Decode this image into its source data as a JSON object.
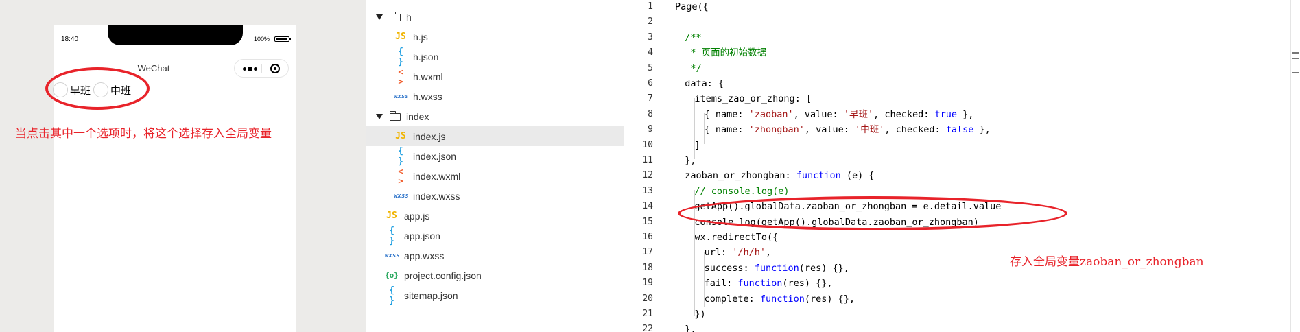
{
  "simulator": {
    "status_time": "18:40",
    "battery_text": "100%",
    "nav_title": "WeChat",
    "radio_items": [
      {
        "label": "早班"
      },
      {
        "label": "中班"
      }
    ],
    "annotation": "当点击其中一个选项时，将这个选择存入全局变量"
  },
  "file_tree": {
    "items": [
      {
        "name": "h",
        "type": "folder"
      },
      {
        "name": "h.js",
        "type": "js"
      },
      {
        "name": "h.json",
        "type": "json"
      },
      {
        "name": "h.wxml",
        "type": "wxml"
      },
      {
        "name": "h.wxss",
        "type": "wxss"
      },
      {
        "name": "index",
        "type": "folder"
      },
      {
        "name": "index.js",
        "type": "js",
        "selected": true
      },
      {
        "name": "index.json",
        "type": "json"
      },
      {
        "name": "index.wxml",
        "type": "wxml"
      },
      {
        "name": "index.wxss",
        "type": "wxss"
      },
      {
        "name": "app.js",
        "type": "js"
      },
      {
        "name": "app.json",
        "type": "json"
      },
      {
        "name": "app.wxss",
        "type": "wxss"
      },
      {
        "name": "project.config.json",
        "type": "config"
      },
      {
        "name": "sitemap.json",
        "type": "json"
      }
    ],
    "icons": {
      "js": "JS",
      "json": "{ }",
      "wxml": "< >",
      "wxss": "wxss",
      "config": "{o}"
    }
  },
  "editor": {
    "lines": [
      [
        [
          "p",
          "Page({"
        ]
      ],
      [],
      [
        [
          "c",
          "/**"
        ]
      ],
      [
        [
          "c",
          " * 页面的初始数据"
        ]
      ],
      [
        [
          "c",
          " */"
        ]
      ],
      [
        [
          "p",
          "data: {"
        ]
      ],
      [
        [
          "p",
          "items_zao_or_zhong: ["
        ]
      ],
      [
        [
          "p",
          "{ name: "
        ],
        [
          "s",
          "'zaoban'"
        ],
        [
          "p",
          ", value: "
        ],
        [
          "s",
          "'早班'"
        ],
        [
          "p",
          ", checked: "
        ],
        [
          "k",
          "true"
        ],
        [
          "p",
          " },"
        ]
      ],
      [
        [
          "p",
          "{ name: "
        ],
        [
          "s",
          "'zhongban'"
        ],
        [
          "p",
          ", value: "
        ],
        [
          "s",
          "'中班'"
        ],
        [
          "p",
          ", checked: "
        ],
        [
          "k",
          "false"
        ],
        [
          "p",
          " },"
        ]
      ],
      [
        [
          "p",
          "]"
        ]
      ],
      [
        [
          "p",
          "},"
        ]
      ],
      [
        [
          "p",
          "zaoban_or_zhongban: "
        ],
        [
          "k",
          "function"
        ],
        [
          "p",
          " (e) {"
        ]
      ],
      [
        [
          "c",
          "// console.log(e)"
        ]
      ],
      [
        [
          "p",
          "getApp().globalData.zaoban_or_zhongban = e.detail.value"
        ]
      ],
      [
        [
          "p",
          "console.log(getApp().globalData.zaoban_or_zhongban)"
        ]
      ],
      [
        [
          "p",
          "wx.redirectTo({"
        ]
      ],
      [
        [
          "p",
          "url: "
        ],
        [
          "s",
          "'/h/h'"
        ],
        [
          "p",
          ","
        ]
      ],
      [
        [
          "p",
          "success: "
        ],
        [
          "k",
          "function"
        ],
        [
          "p",
          "(res) {},"
        ]
      ],
      [
        [
          "p",
          "fail: "
        ],
        [
          "k",
          "function"
        ],
        [
          "p",
          "(res) {},"
        ]
      ],
      [
        [
          "p",
          "complete: "
        ],
        [
          "k",
          "function"
        ],
        [
          "p",
          "(res) {},"
        ]
      ],
      [
        [
          "p",
          "})"
        ]
      ],
      [
        [
          "p",
          "},"
        ]
      ]
    ],
    "annotation": "存入全局变量zaoban_or_zhongban"
  },
  "colors": {
    "annotation_red": "#e8232a",
    "keyword": "#0000ff",
    "string": "#a31515",
    "comment": "#008000"
  }
}
